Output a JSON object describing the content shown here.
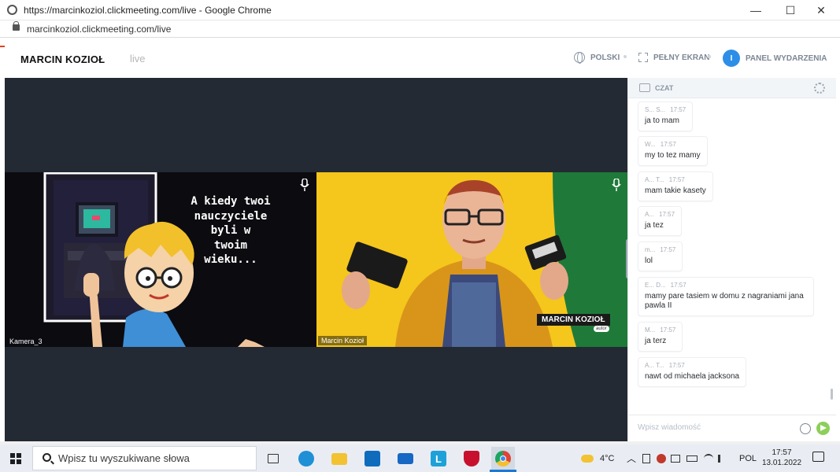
{
  "browser": {
    "window_title": "https://marcinkoziol.clickmeeting.com/live - Google Chrome",
    "url": "marcinkoziol.clickmeeting.com/live",
    "minimize_glyph": "—",
    "maximize_glyph": "☐",
    "close_glyph": "✕"
  },
  "header": {
    "brand": "MARCIN KOZIOŁ",
    "live": "live",
    "language": "POLSKI",
    "fullscreen": "PEŁNY EKRAN",
    "avatar_initial": "I",
    "event_panel": "PANEL WYDARZENIA"
  },
  "stage": {
    "tiles": [
      {
        "label": "Kamera_3",
        "overlay_text": [
          "A kiedy twoi",
          "nauczyciele",
          "byli w",
          "twoim",
          "wieku..."
        ]
      },
      {
        "label": "Marcin Kozioł",
        "lower_third_name": "MARCIN KOZIOŁ",
        "lower_third_role": "autor"
      }
    ]
  },
  "chat": {
    "title": "CZAT",
    "input_placeholder": "Wpisz wiadomość",
    "messages": [
      {
        "author": "S... S...",
        "time": "17:57",
        "text": "ja to mam"
      },
      {
        "author": "W...",
        "time": "17:57",
        "text": "my to tez mamy"
      },
      {
        "author": "A... T...",
        "time": "17:57",
        "text": "mam takie kasety"
      },
      {
        "author": "A...",
        "time": "17:57",
        "text": "ja tez"
      },
      {
        "author": "m...",
        "time": "17:57",
        "text": "lol"
      },
      {
        "author": "E... D...",
        "time": "17:57",
        "text": "mamy pare tasiem w domu z nagraniami jana pawla II"
      },
      {
        "author": "M...",
        "time": "17:57",
        "text": "ja terz"
      },
      {
        "author": "A... T...",
        "time": "17:57",
        "text": "nawt od michaela jacksona"
      }
    ]
  },
  "taskbar": {
    "search_placeholder": "Wpisz tu wyszukiwane słowa",
    "weather": "4°C",
    "language": "POL",
    "time": "17:57",
    "date": "13.01.2022",
    "apps": [
      "task-view",
      "edge",
      "file-explorer",
      "microsoft-store",
      "mail",
      "l-app",
      "mcafee",
      "chrome"
    ],
    "colors": {
      "edge": "#1f8fd6",
      "explorer": "#f2c233",
      "store": "#0f6cbd",
      "mail": "#1767c4",
      "l_app": "#1ea1d8",
      "mcafee": "#c8102e",
      "chrome": "#de4437"
    }
  }
}
